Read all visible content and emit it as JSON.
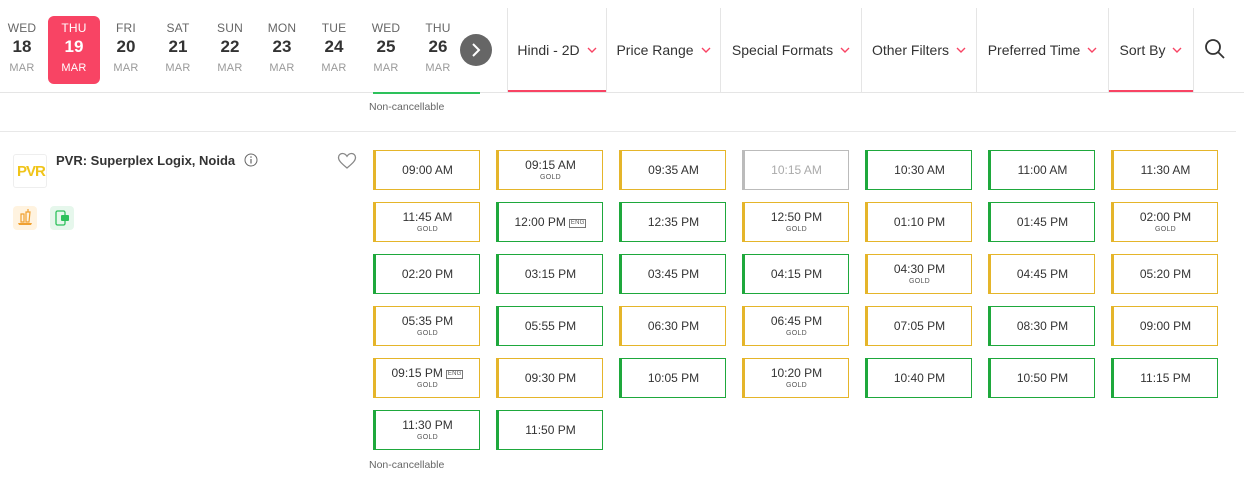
{
  "dates": [
    {
      "dow": "WED",
      "num": "18",
      "mon": "MAR",
      "active": false
    },
    {
      "dow": "THU",
      "num": "19",
      "mon": "MAR",
      "active": true
    },
    {
      "dow": "FRI",
      "num": "20",
      "mon": "MAR",
      "active": false
    },
    {
      "dow": "SAT",
      "num": "21",
      "mon": "MAR",
      "active": false
    },
    {
      "dow": "SUN",
      "num": "22",
      "mon": "MAR",
      "active": false
    },
    {
      "dow": "MON",
      "num": "23",
      "mon": "MAR",
      "active": false
    },
    {
      "dow": "TUE",
      "num": "24",
      "mon": "MAR",
      "active": false
    },
    {
      "dow": "WED",
      "num": "25",
      "mon": "MAR",
      "active": false
    },
    {
      "dow": "THU",
      "num": "26",
      "mon": "MAR",
      "active": false
    }
  ],
  "filters": [
    {
      "label": "Hindi - 2D",
      "selected": true
    },
    {
      "label": "Price Range",
      "selected": false
    },
    {
      "label": "Special Formats",
      "selected": false
    },
    {
      "label": "Other Filters",
      "selected": false
    },
    {
      "label": "Preferred Time",
      "selected": false
    },
    {
      "label": "Sort By",
      "selected": true
    }
  ],
  "colors": {
    "accent": "#f84464",
    "available": "#1ea83c",
    "filling": "#e5b52a",
    "unavailable": "#bbbbbb"
  },
  "prev_note": "Non-cancellable",
  "venue": {
    "logo_text": "PVR",
    "name": "PVR: Superplex Logix, Noida",
    "icons": [
      "info-icon",
      "heart-icon",
      "food-icon",
      "mticket-icon"
    ],
    "note": "Non-cancellable",
    "showtimes": [
      {
        "time": "09:00 AM",
        "gold": false,
        "eng": false,
        "status": "yellow"
      },
      {
        "time": "09:15 AM",
        "gold": true,
        "eng": false,
        "status": "yellow"
      },
      {
        "time": "09:35 AM",
        "gold": false,
        "eng": false,
        "status": "yellow"
      },
      {
        "time": "10:15 AM",
        "gold": false,
        "eng": false,
        "status": "grey"
      },
      {
        "time": "10:30 AM",
        "gold": false,
        "eng": false,
        "status": "green"
      },
      {
        "time": "11:00 AM",
        "gold": false,
        "eng": false,
        "status": "green"
      },
      {
        "time": "11:30 AM",
        "gold": false,
        "eng": false,
        "status": "yellow"
      },
      {
        "time": "11:45 AM",
        "gold": true,
        "eng": false,
        "status": "yellow"
      },
      {
        "time": "12:00 PM",
        "gold": false,
        "eng": true,
        "status": "green"
      },
      {
        "time": "12:35 PM",
        "gold": false,
        "eng": false,
        "status": "green"
      },
      {
        "time": "12:50 PM",
        "gold": true,
        "eng": false,
        "status": "yellow"
      },
      {
        "time": "01:10 PM",
        "gold": false,
        "eng": false,
        "status": "yellow"
      },
      {
        "time": "01:45 PM",
        "gold": false,
        "eng": false,
        "status": "green"
      },
      {
        "time": "02:00 PM",
        "gold": true,
        "eng": false,
        "status": "yellow"
      },
      {
        "time": "02:20 PM",
        "gold": false,
        "eng": false,
        "status": "green"
      },
      {
        "time": "03:15 PM",
        "gold": false,
        "eng": false,
        "status": "green"
      },
      {
        "time": "03:45 PM",
        "gold": false,
        "eng": false,
        "status": "green"
      },
      {
        "time": "04:15 PM",
        "gold": false,
        "eng": false,
        "status": "green"
      },
      {
        "time": "04:30 PM",
        "gold": true,
        "eng": false,
        "status": "yellow"
      },
      {
        "time": "04:45 PM",
        "gold": false,
        "eng": false,
        "status": "yellow"
      },
      {
        "time": "05:20 PM",
        "gold": false,
        "eng": false,
        "status": "yellow"
      },
      {
        "time": "05:35 PM",
        "gold": true,
        "eng": false,
        "status": "yellow"
      },
      {
        "time": "05:55 PM",
        "gold": false,
        "eng": false,
        "status": "green"
      },
      {
        "time": "06:30 PM",
        "gold": false,
        "eng": false,
        "status": "yellow"
      },
      {
        "time": "06:45 PM",
        "gold": true,
        "eng": false,
        "status": "yellow"
      },
      {
        "time": "07:05 PM",
        "gold": false,
        "eng": false,
        "status": "yellow"
      },
      {
        "time": "08:30 PM",
        "gold": false,
        "eng": false,
        "status": "green"
      },
      {
        "time": "09:00 PM",
        "gold": false,
        "eng": false,
        "status": "yellow"
      },
      {
        "time": "09:15 PM",
        "gold": true,
        "eng": true,
        "status": "yellow"
      },
      {
        "time": "09:30 PM",
        "gold": false,
        "eng": false,
        "status": "yellow"
      },
      {
        "time": "10:05 PM",
        "gold": false,
        "eng": false,
        "status": "green"
      },
      {
        "time": "10:20 PM",
        "gold": true,
        "eng": false,
        "status": "yellow"
      },
      {
        "time": "10:40 PM",
        "gold": false,
        "eng": false,
        "status": "green"
      },
      {
        "time": "10:50 PM",
        "gold": false,
        "eng": false,
        "status": "green"
      },
      {
        "time": "11:15 PM",
        "gold": false,
        "eng": false,
        "status": "green"
      },
      {
        "time": "11:30 PM",
        "gold": true,
        "eng": false,
        "status": "green"
      },
      {
        "time": "11:50 PM",
        "gold": false,
        "eng": false,
        "status": "green"
      }
    ]
  },
  "labels": {
    "gold": "GOLD",
    "eng": "ENG"
  }
}
